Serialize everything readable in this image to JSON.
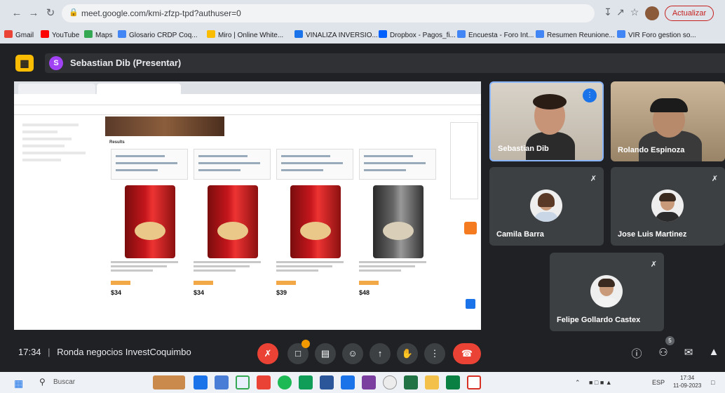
{
  "browser": {
    "url": "meet.google.com/kmi-zfzp-tpd?authuser=0",
    "update_label": "Actualizar",
    "bookmarks": [
      {
        "label": "Gmail",
        "color": "#ea4335"
      },
      {
        "label": "YouTube",
        "color": "#ff0000"
      },
      {
        "label": "Maps",
        "color": "#34a853"
      },
      {
        "label": "Glosario CRDP Coq...",
        "color": "#4285f4"
      },
      {
        "label": "Miro | Online White...",
        "color": "#fbbc04"
      },
      {
        "label": "VINALIZA INVERSIO...",
        "color": "#1a73e8"
      },
      {
        "label": "Dropbox - Pagos_fi...",
        "color": "#0061fe"
      },
      {
        "label": "Encuesta - Foro Int...",
        "color": "#4285f4"
      },
      {
        "label": "Resumen Reunione...",
        "color": "#4285f4"
      },
      {
        "label": "VIR Foro gestion so...",
        "color": "#4285f4"
      }
    ]
  },
  "meet": {
    "presenter_initial": "S",
    "presenter_label": "Sebastian Dib (Presentar)",
    "participants": [
      {
        "name": "Sebastian Dib",
        "speaking": true
      },
      {
        "name": "Rolando Espinoza",
        "speaking": false
      },
      {
        "name": "Camila Barra",
        "muted": true
      },
      {
        "name": "Jose Luis Martinez",
        "muted": true
      },
      {
        "name": "Felipe Gollardo Castex",
        "muted": true
      }
    ],
    "time": "17:34",
    "separator": "|",
    "meeting_name": "Ronda negocios InvestCoquimbo",
    "people_count": "5"
  },
  "shared_screen": {
    "results_label": "Results",
    "prices": [
      "$34",
      "$34",
      "$39",
      "$48"
    ]
  },
  "taskbar": {
    "search_placeholder": "Buscar",
    "clock_time": "17:34",
    "clock_date": "11-09-2023",
    "lang": "ESP"
  },
  "colors": {
    "meet_bg": "#202124",
    "tile_bg": "#3c4043",
    "hangup": "#ea4335",
    "accent": "#8ab4f8"
  }
}
